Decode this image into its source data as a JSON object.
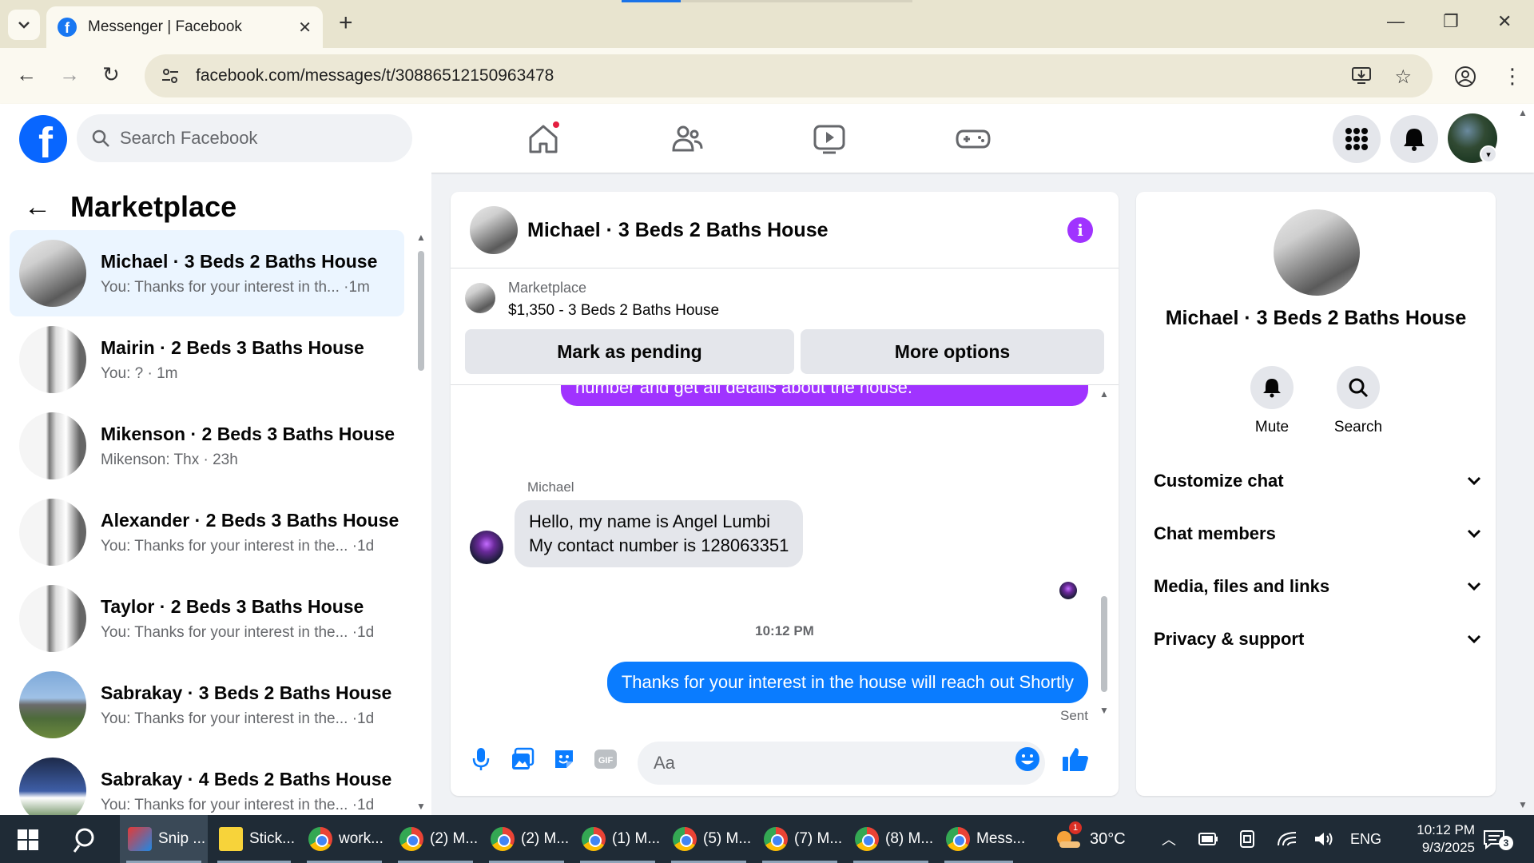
{
  "browser": {
    "tab_title": "Messenger | Facebook",
    "url": "facebook.com/messages/t/30886512150963478"
  },
  "fb_header": {
    "search_placeholder": "Search Facebook",
    "icons": [
      "home-icon",
      "friends-icon",
      "video-icon",
      "gaming-icon",
      "menu-grid-icon",
      "notifications-icon"
    ]
  },
  "left_panel": {
    "title": "Marketplace",
    "conversations": [
      {
        "name": "Michael · 3 Beds 2 Baths House",
        "preview": "You: Thanks for your interest in th...  ·1m",
        "active": true
      },
      {
        "name": "Mairin · 2 Beds 3 Baths House",
        "preview": "You: ? · 1m"
      },
      {
        "name": "Mikenson · 2 Beds 3 Baths House",
        "preview": "Mikenson: Thx · 23h"
      },
      {
        "name": "Alexander · 2 Beds 3 Baths House",
        "preview": "You: Thanks for your interest in the... ·1d"
      },
      {
        "name": "Taylor · 2 Beds 3 Baths House",
        "preview": "You: Thanks for your interest in the... ·1d"
      },
      {
        "name": "Sabrakay · 3 Beds 2 Baths House",
        "preview": "You: Thanks for your interest in the... ·1d"
      },
      {
        "name": "Sabrakay · 4 Beds 2 Baths House",
        "preview": "You: Thanks for your interest in the... ·1d"
      }
    ]
  },
  "chat": {
    "title": "Michael · 3 Beds 2 Baths House",
    "marketplace_label": "Marketplace",
    "listing": "$1,350 - 3 Beds 2 Baths House",
    "mark_pending": "Mark as pending",
    "more_options": "More options",
    "partial_message": "number and get all details about the house.",
    "sender": "Michael",
    "incoming_line1": "Hello, my name is Angel Lumbi",
    "incoming_line2": "My contact number is 128063351",
    "timestamp": "10:12 PM",
    "outgoing": "Thanks for your interest in the house will reach out Shortly",
    "status": "Sent",
    "composer_placeholder": "Aa"
  },
  "info_panel": {
    "name": "Michael · 3 Beds 2 Baths House",
    "mute": "Mute",
    "search": "Search",
    "sections": [
      "Customize chat",
      "Chat members",
      "Media, files and links",
      "Privacy & support"
    ]
  },
  "taskbar": {
    "apps": [
      "Snip ...",
      "Stick...",
      "work...",
      "(2) M...",
      "(2) M...",
      "(1) M...",
      "(5) M...",
      "(7) M...",
      "(8) M...",
      "Mess..."
    ],
    "weather": "30°C",
    "weather_badge": "1",
    "lang": "ENG",
    "time": "10:12 PM",
    "date": "9/3/2025",
    "notif_count": "3"
  },
  "colors": {
    "fb_blue": "#0866ff",
    "messenger_purple": "#a033ff",
    "outgoing_blue": "#0a7cff",
    "active_row": "#ebf5ff"
  }
}
